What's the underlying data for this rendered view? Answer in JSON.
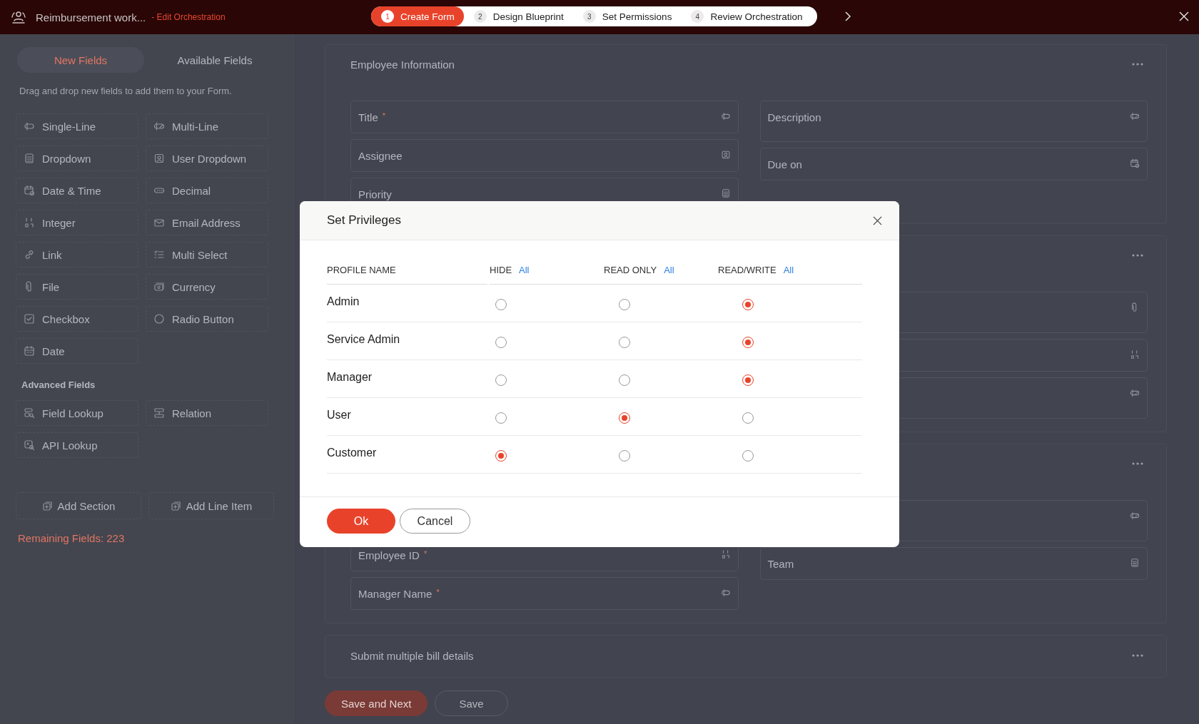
{
  "header": {
    "title": "Reimbursement work...",
    "link": "- Edit Orchestration"
  },
  "steps": [
    {
      "number": "1",
      "label": "Create Form",
      "selected": true
    },
    {
      "number": "2",
      "label": "Design Blueprint",
      "selected": false
    },
    {
      "number": "3",
      "label": "Set Permissions",
      "selected": false
    },
    {
      "number": "4",
      "label": "Review Orchestration",
      "selected": false
    }
  ],
  "sidebar": {
    "tabs": [
      {
        "label": "New Fields",
        "selected": true
      },
      {
        "label": "Available Fields",
        "selected": false
      }
    ],
    "hint": "Drag and drop new fields to add them to your Form.",
    "fields": [
      {
        "label": "Single-Line",
        "kind": "single-line"
      },
      {
        "label": "Multi-Line",
        "kind": "multi-line"
      },
      {
        "label": "Dropdown",
        "kind": "dropdown"
      },
      {
        "label": "User Dropdown",
        "kind": "user"
      },
      {
        "label": "Date & Time",
        "kind": "date-time"
      },
      {
        "label": "Decimal",
        "kind": "decimal"
      },
      {
        "label": "Integer",
        "kind": "integer"
      },
      {
        "label": "Email Address",
        "kind": "email"
      },
      {
        "label": "Link",
        "kind": "link"
      },
      {
        "label": "Multi Select",
        "kind": "multi-select"
      },
      {
        "label": "File",
        "kind": "file"
      },
      {
        "label": "Currency",
        "kind": "currency"
      },
      {
        "label": "Checkbox",
        "kind": "checkbox"
      },
      {
        "label": "Radio Button",
        "kind": "radio"
      },
      {
        "label": "Date",
        "kind": "date"
      }
    ],
    "advanced_heading": "Advanced Fields",
    "advanced_fields": [
      {
        "label": "Field Lookup",
        "kind": "lookup"
      },
      {
        "label": "Relation",
        "kind": "relation"
      },
      {
        "label": "API Lookup",
        "kind": "api"
      }
    ],
    "actions": [
      {
        "label": "Add Section"
      },
      {
        "label": "Add Line Item"
      }
    ],
    "remaining": "Remaining Fields: 223"
  },
  "sections": [
    {
      "title": "Employee Information",
      "left": [
        {
          "label": "Title",
          "marker": "*",
          "kind": "single-line"
        },
        {
          "label": "Assignee",
          "kind": "user"
        },
        {
          "label": "Priority",
          "kind": "dropdown"
        }
      ],
      "right": [
        {
          "label": "Description",
          "kind": "multi-line"
        },
        {
          "label": "Due on",
          "kind": "date-time"
        }
      ]
    },
    {
      "right": [
        {
          "kind": "file"
        },
        {
          "kind": "integer"
        },
        {
          "kind": "multi-line"
        }
      ]
    },
    {
      "left": [
        {
          "label": "Employee ID",
          "marker": "*",
          "kind": "integer"
        },
        {
          "label": "Manager Name",
          "marker": "*",
          "kind": "single-line"
        }
      ],
      "right": [
        {
          "kind": "multi-line"
        },
        {
          "label": "Team",
          "kind": "dropdown"
        }
      ]
    },
    {
      "title": "Submit multiple bill details"
    }
  ],
  "buttons": [
    {
      "label": "Save and Next",
      "kind": "primary"
    },
    {
      "label": "Save",
      "kind": "secondary"
    }
  ],
  "dialog": {
    "title": "Set Privileges",
    "columns": [
      {
        "label": "PROFILE NAME"
      },
      {
        "label": "HIDE",
        "link": "All"
      },
      {
        "label": "READ ONLY",
        "link": "All"
      },
      {
        "label": "READ/WRITE",
        "link": "All"
      }
    ],
    "rows": [
      {
        "name": "Admin",
        "options": [
          {
            "selected": false
          },
          {
            "selected": false
          },
          {
            "selected": true
          }
        ]
      },
      {
        "name": "Service Admin",
        "options": [
          {
            "selected": false
          },
          {
            "selected": false
          },
          {
            "selected": true
          }
        ]
      },
      {
        "name": "Manager",
        "options": [
          {
            "selected": false
          },
          {
            "selected": false
          },
          {
            "selected": true
          }
        ]
      },
      {
        "name": "User",
        "options": [
          {
            "selected": false
          },
          {
            "selected": true
          },
          {
            "selected": false
          }
        ]
      },
      {
        "name": "Customer",
        "options": [
          {
            "selected": true
          },
          {
            "selected": false
          },
          {
            "selected": false
          }
        ]
      }
    ],
    "buttons": [
      {
        "label": "Ok",
        "kind": "primary"
      },
      {
        "label": "Cancel",
        "kind": "secondary"
      }
    ]
  }
}
